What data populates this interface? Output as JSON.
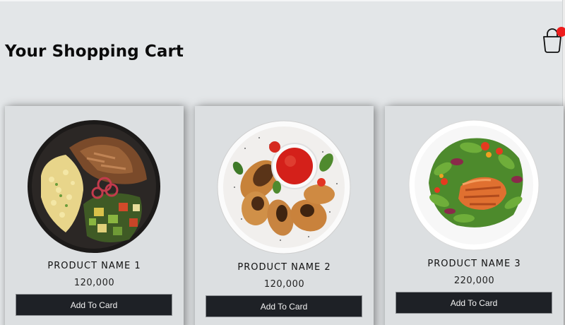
{
  "header": {
    "title": "Your Shopping Cart"
  },
  "cart_icon": {
    "icon": "shopping-bag-icon",
    "badge_color": "#ee1c1c"
  },
  "products": [
    {
      "name": "PRODUCT NAME 1",
      "price": "120,000",
      "button_label": "Add To Card",
      "image": "pulled-pork-corn-salad-bowl"
    },
    {
      "name": "PRODUCT NAME 2",
      "price": "120,000",
      "button_label": "Add To Card",
      "image": "grilled-chicken-wings-with-sauce"
    },
    {
      "name": "PRODUCT NAME 3",
      "price": "220,000",
      "button_label": "Add To Card",
      "image": "salmon-salad-plate"
    }
  ],
  "colors": {
    "background": "#e3e6e8",
    "card": "#dcdfe1",
    "button": "#1e2126",
    "button_text": "#f3f3f3"
  }
}
